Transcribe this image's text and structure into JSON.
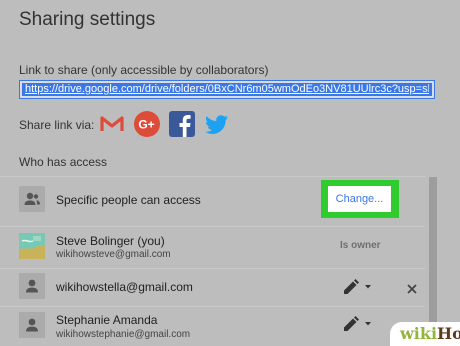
{
  "dialog": {
    "title": "Sharing settings",
    "link_label": "Link to share (only accessible by collaborators)",
    "link_url": "https://drive.google.com/drive/folders/0BxCNr6m05wmOdEo3NV81UUlrc3c?usp=sha",
    "share_via_label": "Share link via:",
    "share_services": [
      {
        "name": "Gmail",
        "icon": "gmail-icon",
        "color": "#dd4b39"
      },
      {
        "name": "Google+",
        "icon": "google-plus-icon",
        "color": "#dd4b39"
      },
      {
        "name": "Facebook",
        "icon": "facebook-icon",
        "color": "#3b5998"
      },
      {
        "name": "Twitter",
        "icon": "twitter-icon",
        "color": "#1da1f2"
      }
    ],
    "who_has_access_label": "Who has access"
  },
  "access": {
    "mode_label": "Specific people can access",
    "change_label": "Change...",
    "highlight_color": "#2fcb2f"
  },
  "people": [
    {
      "name": "Steve Bolinger (you)",
      "email": "wikihowsteve@gmail.com",
      "role": "Is owner",
      "avatar": "photo-avatar"
    },
    {
      "name": "wikihowstella@gmail.com",
      "email": "",
      "role": "can-edit",
      "avatar": "person-icon"
    },
    {
      "name": "Stephanie Amanda",
      "email": "wikihowstephanie@gmail.com",
      "role": "can-edit",
      "avatar": "person-icon"
    }
  ],
  "watermark": {
    "part1": "wiki",
    "part2": "How"
  }
}
